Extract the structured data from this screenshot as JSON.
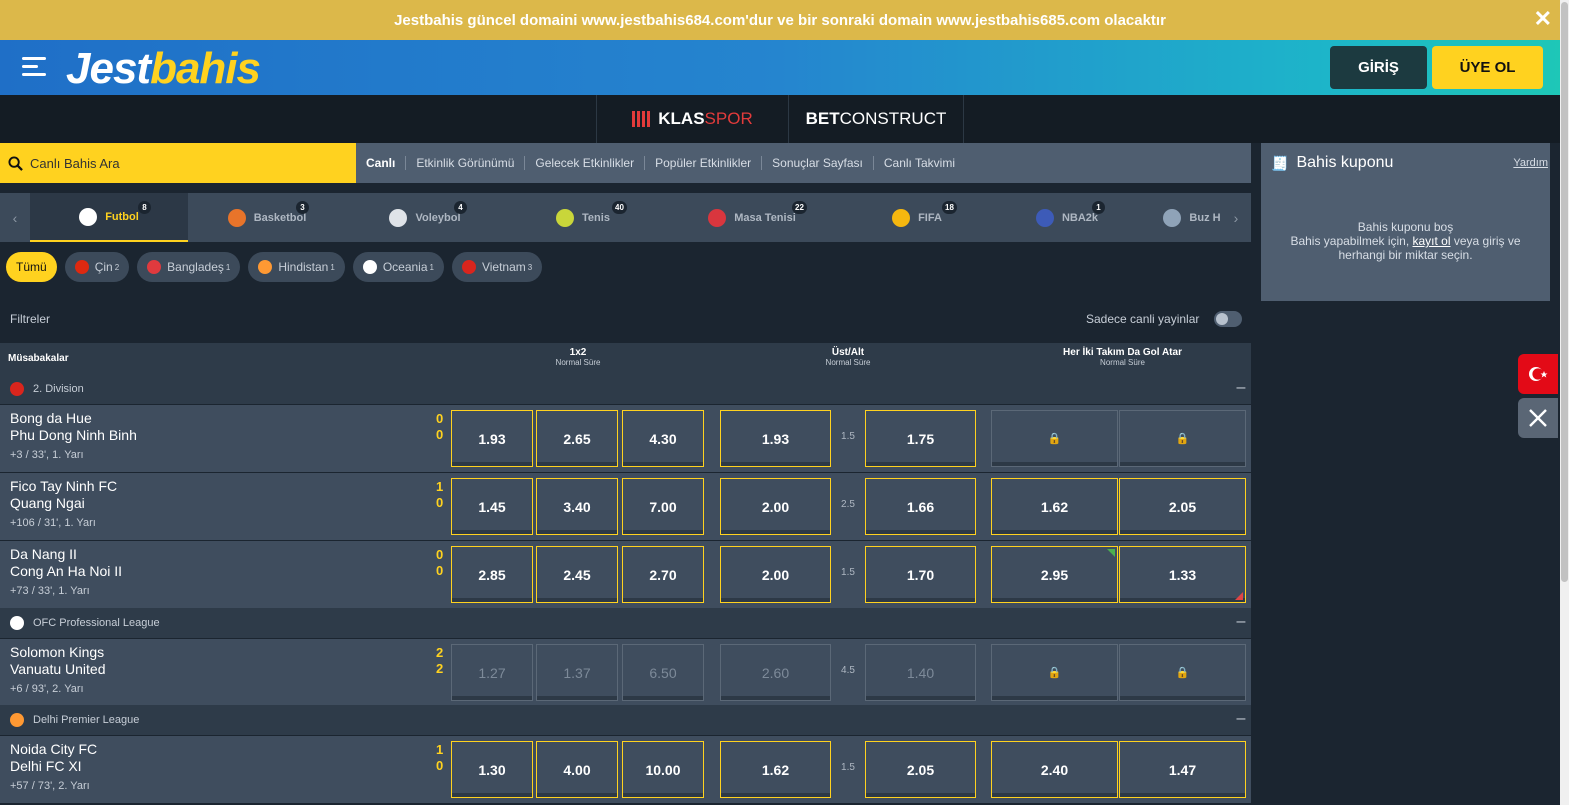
{
  "announce": {
    "text": "Jestbahis güncel domaini www.jestbahis684.com'dur ve bir sonraki domain www.jestbahis685.com olacaktır",
    "close": "✕"
  },
  "header": {
    "logo_a": "Jest",
    "logo_b": "bahis",
    "login": "GİRİŞ",
    "register": "ÜYE OL"
  },
  "partners": {
    "p1_a": "KLAS",
    "p1_b": "SPOR",
    "p2_a": "BET",
    "p2_b": "CONSTRUCT"
  },
  "search": {
    "placeholder": "Canlı Bahis Ara",
    "icon": "search-icon"
  },
  "navlinks": [
    "Canlı",
    "Etkinlik Görünümü",
    "Gelecek Etkinlikler",
    "Popüler Etkinlikler",
    "Sonuçlar Sayfası",
    "Canlı Takvimi"
  ],
  "sports": [
    {
      "label": "Futbol",
      "count": "8",
      "color": "#ffffff"
    },
    {
      "label": "Basketbol",
      "count": "3",
      "color": "#e8742a"
    },
    {
      "label": "Voleybol",
      "count": "4",
      "color": "#dfe3e8"
    },
    {
      "label": "Tenis",
      "count": "40",
      "color": "#c9d63a"
    },
    {
      "label": "Masa Tenisi",
      "count": "22",
      "color": "#d9363e"
    },
    {
      "label": "FIFA",
      "count": "18",
      "color": "#f5b70f"
    },
    {
      "label": "NBA2k",
      "count": "1",
      "color": "#3d5bb8"
    },
    {
      "label": "Buz H",
      "count": "",
      "color": "#8fa3b8"
    }
  ],
  "chips": [
    {
      "label": "Tümü",
      "count": "",
      "color": ""
    },
    {
      "label": "Çin",
      "count": "2",
      "color": "#de2910"
    },
    {
      "label": "Bangladeş",
      "count": "1",
      "color": "#e03a3e"
    },
    {
      "label": "Hindistan",
      "count": "1",
      "color": "#ff9933"
    },
    {
      "label": "Oceania",
      "count": "1",
      "color": "#ffffff"
    },
    {
      "label": "Vietnam",
      "count": "3",
      "color": "#da251d"
    }
  ],
  "filters": {
    "label": "Filtreler",
    "live_only": "Sadece canli yayinlar"
  },
  "table": {
    "col_matches": "Müsabakalar",
    "m1": "1x2",
    "m1_sub": "Normal Süre",
    "m2": "Üst/Alt",
    "m2_sub": "Normal Süre",
    "m3": "Her İki Takım Da Gol Atar",
    "m3_sub": "Normal Süre"
  },
  "leagues": [
    {
      "name": "2. Division",
      "flag": "#da251d"
    },
    {
      "name": "OFC Professional League",
      "flag": "#ffffff"
    },
    {
      "name": "Delhi Premier League",
      "flag": "#ff9933"
    }
  ],
  "matches": [
    {
      "home": "Bong da Hue",
      "away": "Phu Dong Ninh Binh",
      "meta": "+3 / 33', 1. Yarı",
      "sh": "0",
      "sa": "0",
      "o1": "1.93",
      "ox": "2.65",
      "o2": "4.30",
      "over": "1.93",
      "line": "1.5",
      "under": "1.75",
      "yes": "🔒",
      "no": "🔒"
    },
    {
      "home": "Fico Tay Ninh FC",
      "away": "Quang Ngai",
      "meta": "+106 / 31', 1. Yarı",
      "sh": "1",
      "sa": "0",
      "o1": "1.45",
      "ox": "3.40",
      "o2": "7.00",
      "over": "2.00",
      "line": "2.5",
      "under": "1.66",
      "yes": "1.62",
      "no": "2.05"
    },
    {
      "home": "Da Nang II",
      "away": "Cong An Ha Noi II",
      "meta": "+73 / 33', 1. Yarı",
      "sh": "0",
      "sa": "0",
      "o1": "2.85",
      "ox": "2.45",
      "o2": "2.70",
      "over": "2.00",
      "line": "1.5",
      "under": "1.70",
      "yes": "2.95",
      "no": "1.33"
    },
    {
      "home": "Solomon Kings",
      "away": "Vanuatu United",
      "meta": "+6 / 93', 2. Yarı",
      "sh": "2",
      "sa": "2",
      "o1": "1.27",
      "ox": "1.37",
      "o2": "6.50",
      "over": "2.60",
      "line": "4.5",
      "under": "1.40",
      "yes": "🔒",
      "no": "🔒"
    },
    {
      "home": "Noida City FC",
      "away": "Delhi FC XI",
      "meta": "+57 / 73', 2. Yarı",
      "sh": "1",
      "sa": "0",
      "o1": "1.30",
      "ox": "4.00",
      "o2": "10.00",
      "over": "1.62",
      "line": "1.5",
      "under": "2.05",
      "yes": "2.40",
      "no": "1.47"
    }
  ],
  "betslip": {
    "title": "Bahis kuponu",
    "help": "Yardım",
    "empty1": "Bahis kuponu boş",
    "empty2a": "Bahis yapabilmek için, ",
    "empty2link": "kayıt ol",
    "empty2b": " veya giriş ve",
    "empty3": "herhangi bir miktar seçin."
  },
  "colors": {
    "accent": "#ffd21f",
    "announce": "#dcb84a",
    "turkey": "#e30a17"
  }
}
